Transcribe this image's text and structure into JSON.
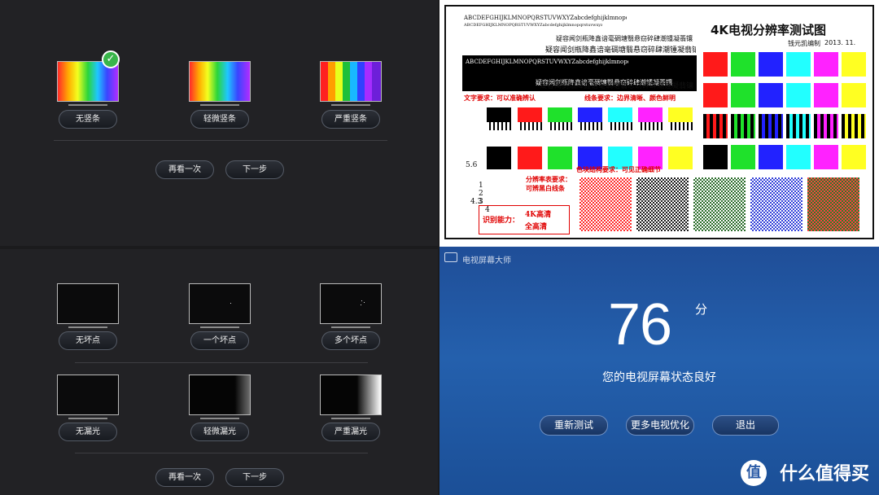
{
  "vbars": {
    "options": [
      "无竖条",
      "轻微竖条",
      "严重竖条"
    ],
    "selected_check": "✓",
    "retry_label": "再看一次",
    "next_label": "下一步"
  },
  "pixels": {
    "row1": [
      "无坏点",
      "一个坏点",
      "多个坏点"
    ],
    "row2": [
      "无漏光",
      "轻微漏光",
      "严重漏光"
    ],
    "retry_label": "再看一次",
    "next_label": "下一步"
  },
  "chart": {
    "title": "4K电视分辨率测试图",
    "author": "钱元凯编制",
    "date": "2013. 11.",
    "alpha1": "ABCDEFGHIJKLMNOPQRSTUVWXYZabcdefghijklmnopqrstuvwxyz",
    "text_req": "文字要求：可以准确辨认",
    "line_req": "线条要求：边界清晰、颜色鲜明",
    "color_req": "色块结构要求：可见正确细节",
    "res_req_1": "分辨率表要求：",
    "res_req_2": "可辨黑白线条",
    "ability_label": "识别能力：",
    "ability_4k": "4K高清",
    "ability_fhd": "全高清",
    "sample_1": "疑容闻剑瓶降鑫谙毫碉塘翳悬窃碎肆潮锺凝翡镶",
    "sample_2": "疑容闻剑瓶降鑫谙毫碉塘翳悬窃碎肆潮锺凝翡镶",
    "scale_56": "5.6",
    "scale_1": "1",
    "scale_2": "2",
    "scale_3": "3",
    "scale_4": "4",
    "scale_43": "4.3"
  },
  "tvmaster": {
    "app_title": "电视屏幕大师",
    "score": "76",
    "unit": "分",
    "status": "您的电视屏幕状态良好",
    "buttons": [
      "重新测试",
      "更多电视优化",
      "退出"
    ],
    "watermark": "什么值得买",
    "watermark_logo": "值"
  },
  "colors": {
    "accent_green": "#39b54a",
    "tv_blue": "#2460ad",
    "chart_red": "#e00000"
  }
}
